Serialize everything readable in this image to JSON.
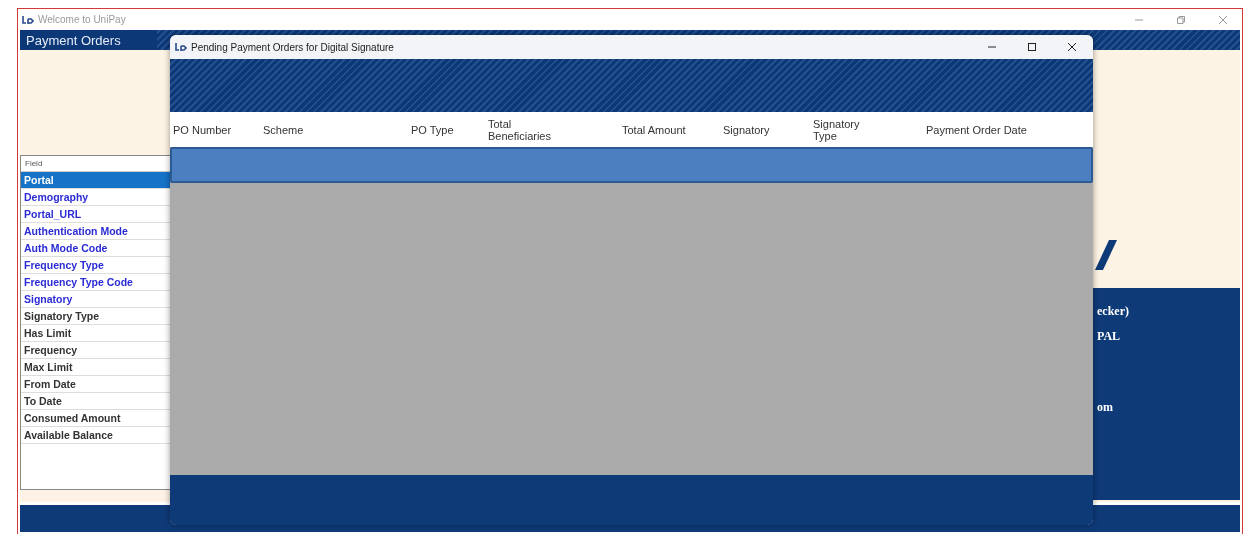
{
  "window": {
    "title": "Welcome to UniPay"
  },
  "header": {
    "title": "Payment Orders"
  },
  "field_list": {
    "header": "Field",
    "items": [
      {
        "label": "Portal",
        "selected": true,
        "kind": "link"
      },
      {
        "label": "Demography",
        "selected": false,
        "kind": "link"
      },
      {
        "label": "Portal_URL",
        "selected": false,
        "kind": "link"
      },
      {
        "label": "Authentication Mode",
        "selected": false,
        "kind": "link"
      },
      {
        "label": "Auth Mode Code",
        "selected": false,
        "kind": "link"
      },
      {
        "label": "Frequency Type",
        "selected": false,
        "kind": "link"
      },
      {
        "label": "Frequency Type Code",
        "selected": false,
        "kind": "link"
      },
      {
        "label": "Signatory",
        "selected": false,
        "kind": "link"
      },
      {
        "label": "Signatory Type",
        "selected": false,
        "kind": "plain"
      },
      {
        "label": "Has Limit",
        "selected": false,
        "kind": "plain"
      },
      {
        "label": "Frequency",
        "selected": false,
        "kind": "plain"
      },
      {
        "label": "Max Limit",
        "selected": false,
        "kind": "plain"
      },
      {
        "label": "From Date",
        "selected": false,
        "kind": "plain"
      },
      {
        "label": "To Date",
        "selected": false,
        "kind": "plain"
      },
      {
        "label": "Consumed Amount",
        "selected": false,
        "kind": "plain"
      },
      {
        "label": "Available Balance",
        "selected": false,
        "kind": "plain"
      }
    ]
  },
  "info_panel": {
    "lines": [
      "ecker)",
      "PAL",
      "om"
    ]
  },
  "dialog": {
    "title": "Pending Payment Orders for Digital Signature",
    "table": {
      "columns": [
        "PO Number",
        "Scheme",
        "PO Type",
        "Total Beneficiaries",
        "Total Amount",
        "Signatory",
        "Signatory Type",
        "Payment Order Date"
      ],
      "rows": [
        {
          "selected": true
        }
      ]
    }
  }
}
